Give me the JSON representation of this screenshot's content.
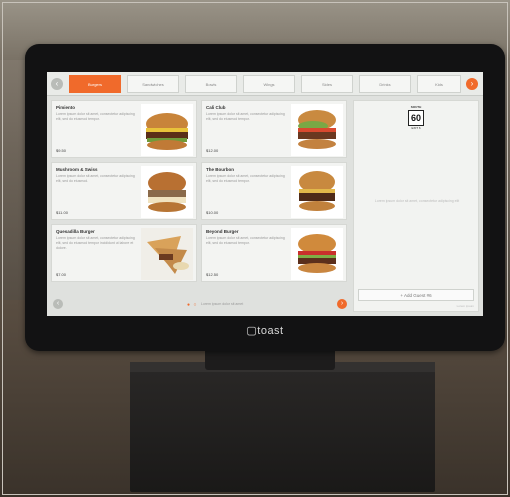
{
  "device": {
    "brand": "▢toast"
  },
  "tabs": [
    {
      "label": "Burgers",
      "active": true
    },
    {
      "label": "Sandwiches",
      "active": false
    },
    {
      "label": "Bowls",
      "active": false
    },
    {
      "label": "Wings",
      "active": false
    },
    {
      "label": "Sides",
      "active": false
    },
    {
      "label": "Drinks",
      "active": false
    },
    {
      "label": "Kids",
      "active": false
    }
  ],
  "menu_items": [
    {
      "name": "Pimiento",
      "desc": "Lorem ipsum dolor sit amet, consectetur adipiscing elit, sed do eiusmod tempor.",
      "price": "$9.50"
    },
    {
      "name": "Cali Club",
      "desc": "Lorem ipsum dolor sit amet, consectetur adipiscing elit, sed do eiusmod tempor.",
      "price": "$12.00"
    },
    {
      "name": "Mushroom & Swiss",
      "desc": "Lorem ipsum dolor sit amet, consectetur adipiscing elit, sed do eiusmod.",
      "price": "$11.00"
    },
    {
      "name": "The Bourbon",
      "desc": "Lorem ipsum dolor sit amet, consectetur adipiscing elit, sed do eiusmod tempor.",
      "price": "$10.00"
    },
    {
      "name": "Quesadilla Burger",
      "desc": "Lorem ipsum dolor sit amet, consectetur adipiscing elit, sed do eiusmod tempor incididunt ut labore et dolore.",
      "price": "$7.00"
    },
    {
      "name": "Beyond Burger",
      "desc": "Lorem ipsum dolor sit amet, consectetur adipiscing elit, sed do eiusmod tempor.",
      "price": "$12.50"
    }
  ],
  "pager": {
    "dots": "● ○",
    "note": "Lorem ipsum dolor sit amet"
  },
  "order": {
    "sign_top": "SOUTH",
    "sign_num": "60",
    "sign_bottom": "EXIT 6",
    "empty_note": "Lorem ipsum dolor sit amet, consectetur adipiscing elit",
    "add_guest": "+ Add Guest #6",
    "footer": "Lorem ipsum"
  },
  "colors": {
    "accent": "#f06a2b",
    "screen_bg": "#dfe1de",
    "bezel": "#121213"
  }
}
